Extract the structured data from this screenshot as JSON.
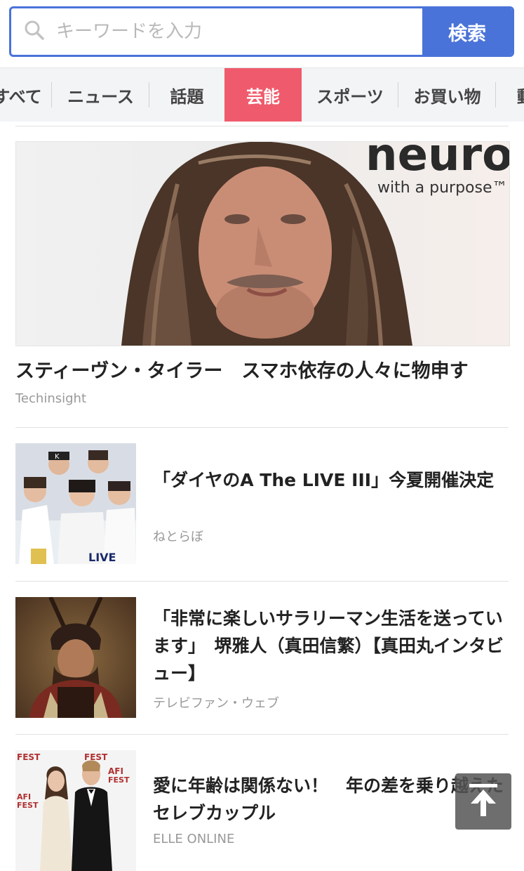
{
  "search": {
    "placeholder": "キーワードを入力",
    "value": "",
    "button_label": "検索"
  },
  "tabs": [
    {
      "label": "すべて",
      "active": false
    },
    {
      "label": "ニュース",
      "active": false
    },
    {
      "label": "話題",
      "active": false
    },
    {
      "label": "芸能",
      "active": true
    },
    {
      "label": "スポーツ",
      "active": false
    },
    {
      "label": "お買い物",
      "active": false
    },
    {
      "label": "動画",
      "active": false
    }
  ],
  "hero": {
    "title": "スティーヴン・タイラー　スマホ依存の人々に物申す",
    "source": "Techinsight",
    "image_text_1": "neuro",
    "image_text_2": "with a purpose™"
  },
  "articles": [
    {
      "title": "「ダイヤのA The LIVE III」今夏開催決定",
      "source": "ねとらぼ"
    },
    {
      "title": "「非常に楽しいサラリーマン生活を送っています」　堺雅人（真田信繁）【真田丸インタビュー】",
      "source": "テレビファン・ウェブ"
    },
    {
      "title": "愛に年齢は関係ない！　年の差を乗り越えたセレブカップル",
      "source": "ELLE ONLINE"
    }
  ],
  "thumb_text": {
    "cap_letter": "K",
    "jersey": "LIVE",
    "afi": "AFI",
    "fest": "FEST"
  },
  "colors": {
    "accent": "#4a73d9",
    "active_tab": "#ef5b6c",
    "tab_bg": "#f2f4f6"
  },
  "icons": {
    "search": "search-icon",
    "scroll_top": "arrow-up-icon"
  }
}
